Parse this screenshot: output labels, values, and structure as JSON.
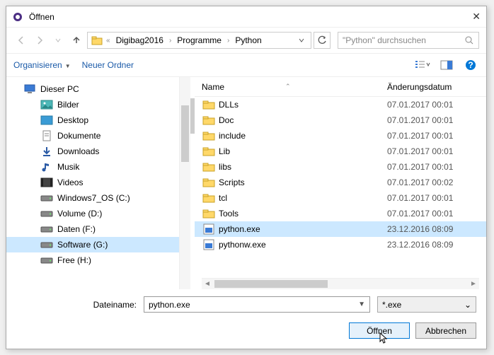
{
  "title": "Öffnen",
  "breadcrumb": {
    "hidden_indicator": "«",
    "p1": "Digibag2016",
    "p2": "Programme",
    "p3": "Python"
  },
  "search_placeholder": "\"Python\" durchsuchen",
  "toolbar": {
    "organize": "Organisieren",
    "new_folder": "Neuer Ordner"
  },
  "columns": {
    "name": "Name",
    "date": "Änderungsdatum"
  },
  "sidebar": {
    "items": [
      {
        "label": "Dieser PC",
        "icon": "pc"
      },
      {
        "label": "Bilder",
        "icon": "pictures"
      },
      {
        "label": "Desktop",
        "icon": "desktop"
      },
      {
        "label": "Dokumente",
        "icon": "documents"
      },
      {
        "label": "Downloads",
        "icon": "downloads"
      },
      {
        "label": "Musik",
        "icon": "music"
      },
      {
        "label": "Videos",
        "icon": "videos"
      },
      {
        "label": "Windows7_OS (C:)",
        "icon": "drive"
      },
      {
        "label": "Volume (D:)",
        "icon": "drive"
      },
      {
        "label": "Daten (F:)",
        "icon": "drive"
      },
      {
        "label": "Software (G:)",
        "icon": "drive",
        "selected": true
      },
      {
        "label": "Free (H:)",
        "icon": "drive"
      }
    ]
  },
  "files": [
    {
      "name": "DLLs",
      "date": "07.01.2017 00:01",
      "type": "folder"
    },
    {
      "name": "Doc",
      "date": "07.01.2017 00:01",
      "type": "folder"
    },
    {
      "name": "include",
      "date": "07.01.2017 00:01",
      "type": "folder"
    },
    {
      "name": "Lib",
      "date": "07.01.2017 00:01",
      "type": "folder"
    },
    {
      "name": "libs",
      "date": "07.01.2017 00:01",
      "type": "folder"
    },
    {
      "name": "Scripts",
      "date": "07.01.2017 00:02",
      "type": "folder"
    },
    {
      "name": "tcl",
      "date": "07.01.2017 00:01",
      "type": "folder"
    },
    {
      "name": "Tools",
      "date": "07.01.2017 00:01",
      "type": "folder"
    },
    {
      "name": "python.exe",
      "date": "23.12.2016 08:09",
      "type": "exe",
      "selected": true
    },
    {
      "name": "pythonw.exe",
      "date": "23.12.2016 08:09",
      "type": "exe"
    }
  ],
  "footer": {
    "filename_label": "Dateiname:",
    "filename_value": "python.exe",
    "filter": "*.exe",
    "open": "Öffnen",
    "cancel": "Abbrechen"
  }
}
